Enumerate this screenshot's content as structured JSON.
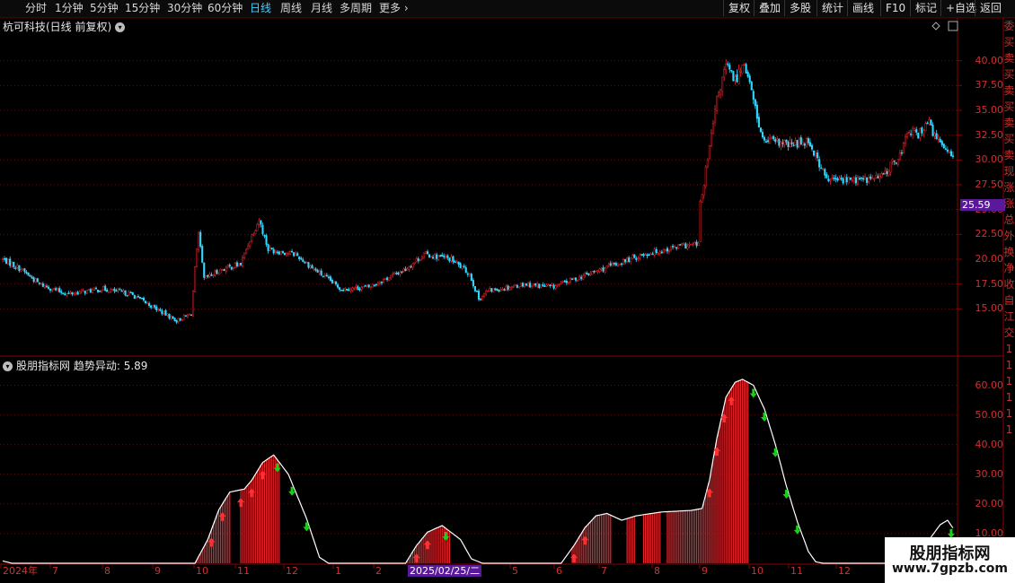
{
  "toolbar": {
    "periods": [
      {
        "label": "分时",
        "active": false
      },
      {
        "label": "1分钟",
        "active": false
      },
      {
        "label": "5分钟",
        "active": false
      },
      {
        "label": "15分钟",
        "active": false
      },
      {
        "label": "30分钟",
        "active": false
      },
      {
        "label": "60分钟",
        "active": false
      },
      {
        "label": "日线",
        "active": true
      },
      {
        "label": "周线",
        "active": false
      },
      {
        "label": "月线",
        "active": false
      },
      {
        "label": "多周期",
        "active": false
      }
    ],
    "more_label": "更多",
    "more_icon": "chevron-right-icon",
    "right_buttons": [
      "复权",
      "叠加",
      "多股",
      "统计",
      "画线",
      "F10",
      "标记",
      "+自选",
      "返回"
    ]
  },
  "main_chart": {
    "title": "杭可科技(日线 前复权)",
    "y_ticks": [
      "40.00",
      "37.50",
      "35.00",
      "32.50",
      "30.00",
      "27.50",
      "25.00",
      "22.50",
      "20.00",
      "17.50",
      "15.00"
    ],
    "current_price": "25.59",
    "up_color": "#e8232b",
    "down_color": "#36d7ff"
  },
  "indicator": {
    "name": "股朋指标网",
    "series_label": "趋势异动:",
    "value": "5.89",
    "y_ticks": [
      "60.00",
      "50.00",
      "40.00",
      "30.00",
      "20.00",
      "10.00"
    ],
    "bar_color": "#e8232b",
    "line_color": "#ffffff",
    "up_arrow_color": "#ff3030",
    "down_arrow_color": "#19d019"
  },
  "x_axis": {
    "labels": [
      "2024年",
      "7",
      "8",
      "9",
      "10",
      "11",
      "12",
      "1",
      "2",
      "5",
      "6",
      "7",
      "8",
      "9",
      "10",
      "11",
      "12"
    ],
    "cursor_date": "2025/02/25/二"
  },
  "right_strip": [
    "委",
    "买",
    "卖",
    "买",
    "卖",
    "买",
    "卖",
    "买",
    "卖",
    "现",
    "涨",
    "涨",
    "总",
    "外",
    "换",
    "净",
    "收",
    "自",
    "江",
    "交",
    "1",
    "1",
    "1",
    "1",
    "1",
    "1"
  ],
  "watermark": {
    "title": "股朋指标网",
    "url": "www.7gpzb.com"
  },
  "chart_data": {
    "type": "candlestick+histogram",
    "price_ylim": [
      12.5,
      42.5
    ],
    "indicator_ylim": [
      0,
      65
    ],
    "price_waypoints": [
      [
        0,
        20
      ],
      [
        10,
        19
      ],
      [
        20,
        17.5
      ],
      [
        35,
        16.5
      ],
      [
        55,
        17
      ],
      [
        70,
        16.5
      ],
      [
        95,
        13.8
      ],
      [
        103,
        14.5
      ],
      [
        105,
        19
      ],
      [
        107,
        22.5
      ],
      [
        110,
        18
      ],
      [
        120,
        19
      ],
      [
        130,
        19.5
      ],
      [
        135,
        22
      ],
      [
        140,
        24
      ],
      [
        145,
        21
      ],
      [
        160,
        20.5
      ],
      [
        170,
        19
      ],
      [
        185,
        17
      ],
      [
        200,
        17.2
      ],
      [
        220,
        19
      ],
      [
        230,
        20.5
      ],
      [
        245,
        20
      ],
      [
        255,
        18.5
      ],
      [
        260,
        16
      ],
      [
        265,
        16.8
      ],
      [
        285,
        17.5
      ],
      [
        300,
        17.2
      ],
      [
        320,
        18.5
      ],
      [
        335,
        19.5
      ],
      [
        350,
        20.5
      ],
      [
        370,
        21.3
      ],
      [
        380,
        21.5
      ],
      [
        381,
        25.5
      ],
      [
        385,
        30
      ],
      [
        390,
        36
      ],
      [
        395,
        39.5
      ],
      [
        400,
        38
      ],
      [
        405,
        40
      ],
      [
        410,
        36
      ],
      [
        415,
        32
      ],
      [
        430,
        31.5
      ],
      [
        440,
        32
      ],
      [
        450,
        28
      ],
      [
        470,
        28
      ],
      [
        480,
        28.3
      ],
      [
        490,
        30.5
      ],
      [
        495,
        33
      ],
      [
        500,
        32.5
      ],
      [
        505,
        34
      ],
      [
        510,
        32
      ],
      [
        520,
        30.5
      ]
    ],
    "indicator_waypoints": [
      [
        0,
        0.8
      ],
      [
        5,
        0
      ],
      [
        105,
        0
      ],
      [
        112,
        8
      ],
      [
        118,
        18
      ],
      [
        124,
        24
      ],
      [
        132,
        25
      ],
      [
        136,
        28
      ],
      [
        142,
        34
      ],
      [
        148,
        36.5
      ],
      [
        156,
        30
      ],
      [
        166,
        15
      ],
      [
        173,
        2
      ],
      [
        178,
        0
      ],
      [
        220,
        0
      ],
      [
        226,
        6
      ],
      [
        232,
        10.5
      ],
      [
        240,
        12.7
      ],
      [
        250,
        8
      ],
      [
        256,
        1.5
      ],
      [
        262,
        0
      ],
      [
        305,
        0
      ],
      [
        312,
        6
      ],
      [
        318,
        12
      ],
      [
        324,
        16
      ],
      [
        330,
        16.8
      ],
      [
        338,
        14.5
      ],
      [
        346,
        16
      ],
      [
        360,
        17.3
      ],
      [
        376,
        17.8
      ],
      [
        382,
        18.5
      ],
      [
        386,
        28
      ],
      [
        390,
        42
      ],
      [
        395,
        56
      ],
      [
        400,
        61
      ],
      [
        404,
        62
      ],
      [
        410,
        60
      ],
      [
        416,
        52
      ],
      [
        422,
        40
      ],
      [
        428,
        26
      ],
      [
        434,
        14
      ],
      [
        440,
        4
      ],
      [
        444,
        0.5
      ],
      [
        448,
        0
      ],
      [
        500,
        0
      ],
      [
        506,
        8
      ],
      [
        512,
        13
      ],
      [
        516,
        14.5
      ],
      [
        520,
        11
      ]
    ],
    "up_arrow_x": [
      114,
      120,
      130,
      136,
      142,
      226,
      232,
      312,
      318,
      386,
      390,
      394,
      398
    ],
    "down_arrow_x": [
      150,
      158,
      166,
      242,
      410,
      416,
      422,
      428,
      434,
      518
    ],
    "bar_gaps": [
      [
        125,
        129
      ],
      [
        152,
        215
      ],
      [
        245,
        310
      ],
      [
        333,
        340
      ],
      [
        346,
        349
      ],
      [
        360,
        362
      ],
      [
        408,
        520
      ]
    ]
  }
}
